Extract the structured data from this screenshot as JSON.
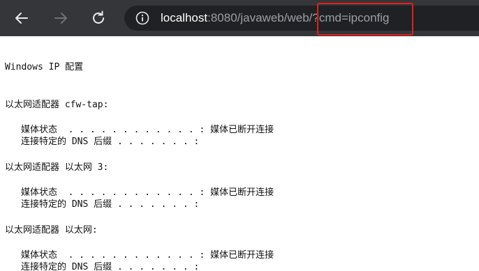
{
  "toolbar": {
    "back_icon": "back-arrow-icon",
    "forward_icon": "forward-arrow-icon",
    "reload_icon": "reload-icon",
    "info_icon": "info-icon"
  },
  "address_bar": {
    "host": "localhost",
    "rest": ":8080/javaweb/web/?cmd=ipconfig"
  },
  "output": {
    "title": "Windows IP 配置",
    "adapters": [
      {
        "header": "以太网适配器 cfw-tap:",
        "media_state": "媒体状态  . . . . . . . . . . . . : 媒体已断开连接",
        "dns_suffix": "连接特定的 DNS 后缀 . . . . . . . :"
      },
      {
        "header": "以太网适配器 以太网 3:",
        "media_state": "媒体状态  . . . . . . . . . . . . : 媒体已断开连接",
        "dns_suffix": "连接特定的 DNS 后缀 . . . . . . . :"
      },
      {
        "header": "以太网适配器 以太网:",
        "media_state": "媒体状态  . . . . . . . . . . . . : 媒体已断开连接",
        "dns_suffix": "连接特定的 DNS 后缀 . . . . . . . :"
      }
    ]
  },
  "colors": {
    "toolbar_bg": "#35363a",
    "address_bg": "#202124",
    "highlight": "#e0201a"
  }
}
